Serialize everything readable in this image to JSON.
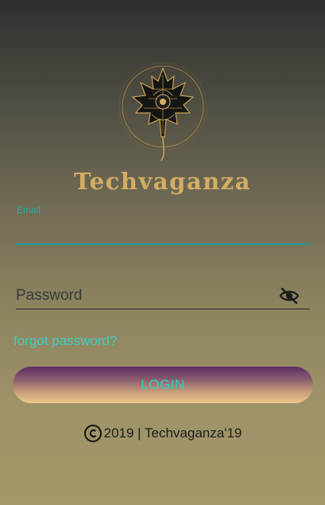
{
  "app": {
    "brand_name": "Techvaganza",
    "logo_icon": "maple-leaf-emblem-icon"
  },
  "form": {
    "email_label": "Email",
    "email_value": "",
    "password_placeholder": "Password",
    "password_value": "",
    "visibility_icon": "eye-off-icon",
    "forgot_label": "forgot password?",
    "login_label": "LOGIN"
  },
  "footer": {
    "copyright_icon": "copyright-icon",
    "text": "2019 | Techvaganza'19"
  },
  "colors": {
    "accent_teal": "#1c9e96",
    "link_teal": "#3ad1bd",
    "brand_gold": "#d4ad63"
  }
}
